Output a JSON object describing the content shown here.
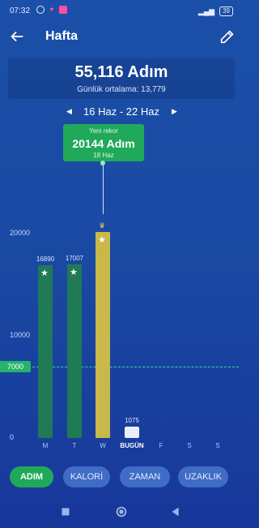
{
  "status": {
    "time": "07:32",
    "battery": "39"
  },
  "header": {
    "title": "Hafta"
  },
  "summary": {
    "steps_line": "55,116 Adım",
    "avg_line": "Günlük ortalama:  13,779"
  },
  "week_nav": {
    "label": "16 Haz - 22 Haz"
  },
  "tooltip": {
    "title": "Yeni rekor",
    "value": "20144 Adım",
    "date": "18 Haz"
  },
  "chart_data": {
    "type": "bar",
    "categories": [
      "M",
      "T",
      "W",
      "BUGÜN",
      "F",
      "S",
      "S"
    ],
    "values": [
      16890,
      17007,
      20144,
      1075,
      null,
      null,
      null
    ],
    "ylim": [
      0,
      20000
    ],
    "yticks": [
      "20000",
      "10000",
      "0"
    ],
    "goal": 7000,
    "goal_label": "7000",
    "value_labels": [
      "16890",
      "17007",
      "",
      "1075",
      "",
      "",
      ""
    ],
    "colors": {
      "achieved": "#1f7a55",
      "record": "#c9b84a",
      "today": "#e9eef7",
      "goal": "#27b36a"
    }
  },
  "tabs": [
    {
      "label": "ADIM",
      "active": true
    },
    {
      "label": "KALORİ",
      "active": false
    },
    {
      "label": "ZAMAN",
      "active": false
    },
    {
      "label": "UZAKLIK",
      "active": false
    }
  ]
}
